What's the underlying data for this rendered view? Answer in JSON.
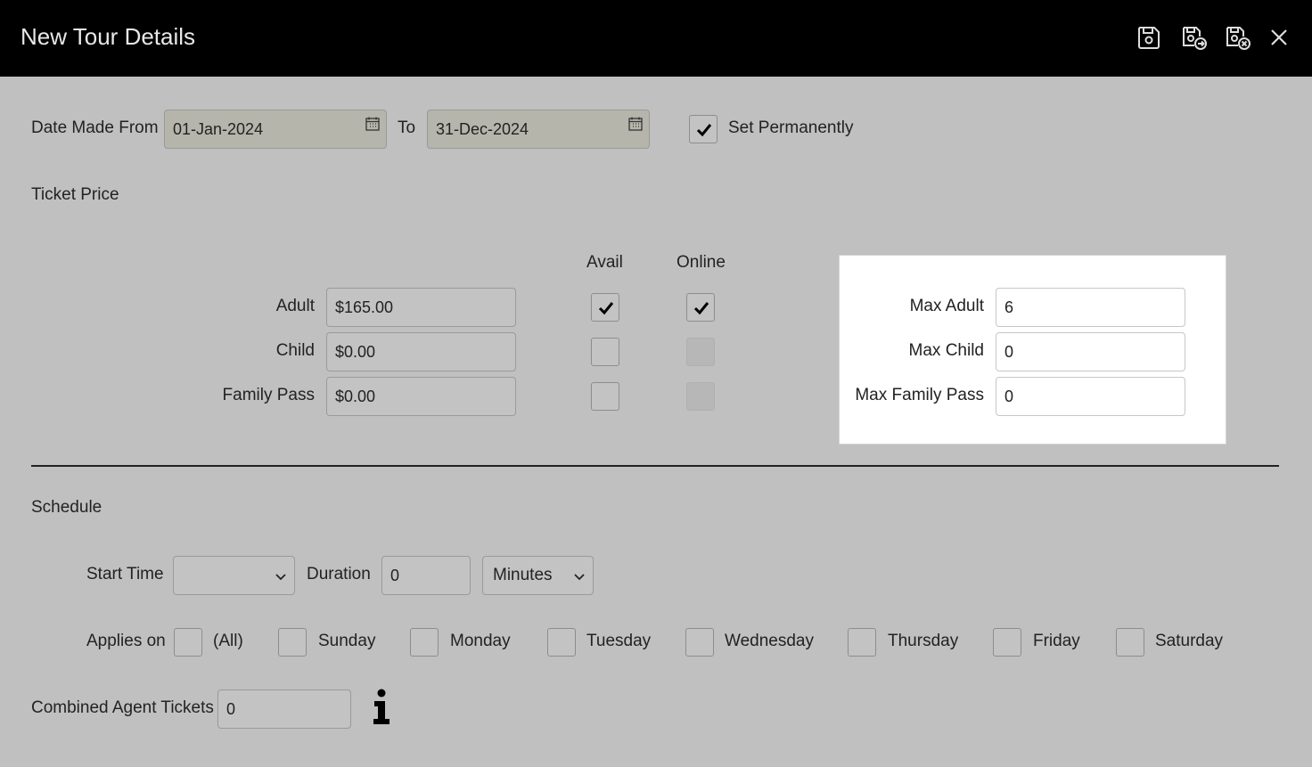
{
  "window": {
    "title": "New Tour Details"
  },
  "toolbar": {
    "icons": [
      "save-icon",
      "save-and-new-icon",
      "save-and-close-icon",
      "close-icon"
    ]
  },
  "date_range": {
    "from_label": "Date Made From",
    "from_value": "01-Jan-2024",
    "to_label": "To",
    "to_value": "31-Dec-2024",
    "set_permanently_label": "Set Permanently",
    "set_permanently_checked": true
  },
  "ticket_price": {
    "section_label": "Ticket Price",
    "avail_header": "Avail",
    "online_header": "Online",
    "rows": [
      {
        "label": "Adult",
        "price": "$165.00",
        "avail": true,
        "online": true,
        "online_enabled": true
      },
      {
        "label": "Child",
        "price": "$0.00",
        "avail": false,
        "online": false,
        "online_enabled": false
      },
      {
        "label": "Family Pass",
        "price": "$0.00",
        "avail": false,
        "online": false,
        "online_enabled": false
      }
    ],
    "max": [
      {
        "label": "Max Adult",
        "value": "6"
      },
      {
        "label": "Max Child",
        "value": "0"
      },
      {
        "label": "Max Family Pass",
        "value": "0"
      }
    ]
  },
  "schedule": {
    "section_label": "Schedule",
    "start_time_label": "Start Time",
    "start_time_value": "",
    "duration_label": "Duration",
    "duration_value": "0",
    "duration_unit": "Minutes",
    "applies_on_label": "Applies on",
    "days": [
      {
        "label": "(All)",
        "checked": false
      },
      {
        "label": "Sunday",
        "checked": false
      },
      {
        "label": "Monday",
        "checked": false
      },
      {
        "label": "Tuesday",
        "checked": false
      },
      {
        "label": "Wednesday",
        "checked": false
      },
      {
        "label": "Thursday",
        "checked": false
      },
      {
        "label": "Friday",
        "checked": false
      },
      {
        "label": "Saturday",
        "checked": false
      }
    ],
    "combined_agent_tickets_label": "Combined Agent Tickets",
    "combined_agent_tickets_value": "0"
  }
}
